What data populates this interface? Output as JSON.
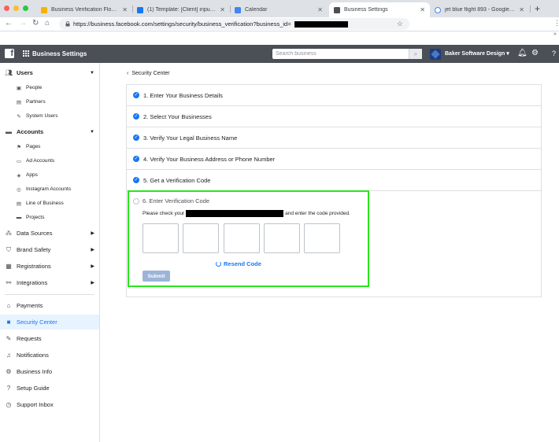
{
  "browser": {
    "tabs": [
      {
        "title": "Business Verification Flow - Go",
        "favicon_color": "#f4b400"
      },
      {
        "title": "(1) Template: [Client] input to L",
        "favicon_color": "#1877f2"
      },
      {
        "title": "Calendar",
        "favicon_color": "#4285f4"
      },
      {
        "title": "Business Settings",
        "favicon_color": "#4b4f56"
      },
      {
        "title": "jet blue flight 893 - Google Se",
        "favicon_color": "#4285f4"
      }
    ],
    "url": "https://business.facebook.com/settings/security/business_verification?business_id=",
    "overflow_glyph": "»"
  },
  "fbbar": {
    "logo": "f",
    "title": "Business Settings",
    "search_placeholder": "Search business",
    "business_name": "Baker Software Design"
  },
  "sidebar": {
    "users_header": "Users",
    "people": "People",
    "partners": "Partners",
    "system_users": "System Users",
    "accounts_header": "Accounts",
    "pages": "Pages",
    "ad_accounts": "Ad Accounts",
    "apps": "Apps",
    "instagram_accounts": "Instagram Accounts",
    "line_of_business": "Line of Business",
    "projects": "Projects",
    "data_sources": "Data Sources",
    "brand_safety": "Brand Safety",
    "registrations": "Registrations",
    "integrations": "Integrations",
    "payments": "Payments",
    "security_center": "Security Center",
    "requests": "Requests",
    "notifications": "Notifications",
    "business_info": "Business Info",
    "setup_guide": "Setup Guide",
    "support_inbox": "Support Inbox"
  },
  "main": {
    "breadcrumb": "Security Center",
    "steps": [
      "1. Enter Your Business Details",
      "2. Select Your Businesses",
      "3. Verify Your Legal Business Name",
      "4. Verify Your Business Address or Phone Number",
      "5. Get a Verification Code"
    ],
    "step6_title": "6. Enter Verification Code",
    "step6_desc_pre": "Please check your",
    "step6_desc_post": "and enter the code provided.",
    "resend": "Resend Code",
    "submit": "Submit"
  },
  "colors": {
    "accent": "#1877f2",
    "highlight": "#29e51d",
    "topbar": "#4b4f56"
  }
}
